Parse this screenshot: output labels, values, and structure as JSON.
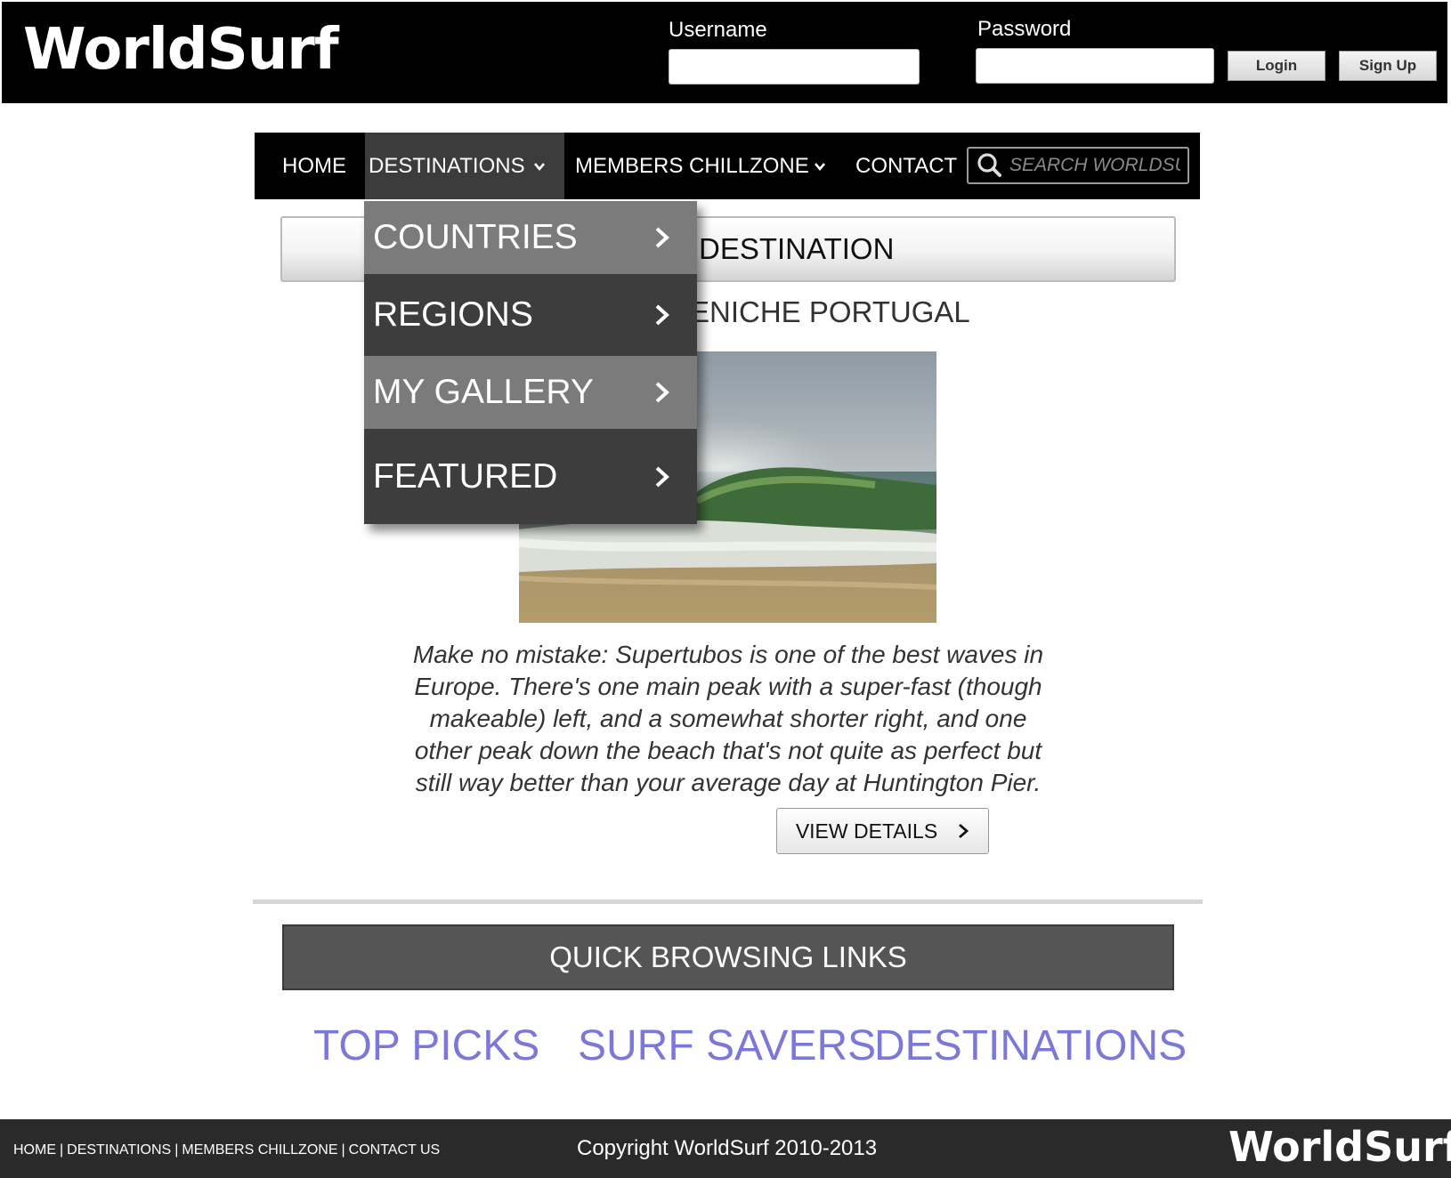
{
  "header": {
    "logo": "WorldSurf",
    "username_label": "Username",
    "password_label": "Password",
    "username_value": "",
    "password_value": "",
    "login_button": "Login",
    "signup_button": "Sign Up"
  },
  "nav": {
    "items": [
      {
        "label": "HOME"
      },
      {
        "label": "DESTINATIONS"
      },
      {
        "label": "MEMBERS CHILLZONE"
      },
      {
        "label": "CONTACT"
      }
    ],
    "search_placeholder": "SEARCH WORLDSURF"
  },
  "dropdown": {
    "items": [
      {
        "label": "COUNTRIES"
      },
      {
        "label": "REGIONS"
      },
      {
        "label": "MY GALLERY"
      },
      {
        "label": "FEATURED"
      }
    ]
  },
  "featured": {
    "section_title_visible": "DESTINATION",
    "place_visible": "ENICHE PORTUGAL",
    "description": "Make no mistake: Supertubos is one of the best waves in Europe. There's one main peak with a super-fast (though makeable) left, and a somewhat shorter right, and one other peak down the beach that's not quite as perfect but still way better than your average day at Huntington Pier.",
    "view_button": "VIEW DETAILS"
  },
  "quick_links": {
    "title": "QUICK BROWSING LINKS",
    "items": [
      {
        "label": "TOP PICKS"
      },
      {
        "label": "SURF SAVERS"
      },
      {
        "label": "DESTINATIONS"
      }
    ]
  },
  "footer": {
    "links": [
      {
        "label": "HOME"
      },
      {
        "label": "DESTINATIONS"
      },
      {
        "label": "MEMBERS CHILLZONE"
      },
      {
        "label": "CONTACT US"
      }
    ],
    "separator": "|",
    "copyright": "Copyright WorldSurf 2010-2013",
    "logo": "WorldSurf"
  },
  "colors": {
    "header_bg": "#000000",
    "nav_active": "#3c3c3c",
    "dropdown_light": "#7b7b7b",
    "dropdown_dark": "#3d3d3d",
    "quick_link": "#7b78d9",
    "footer_bg": "#2a2a2a"
  }
}
